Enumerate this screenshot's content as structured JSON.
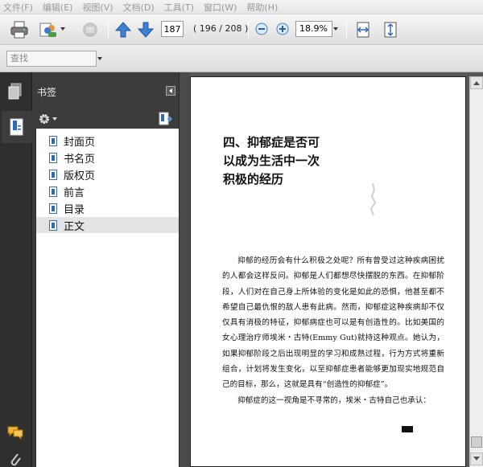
{
  "menu": [
    "文件(F)",
    "编辑(E)",
    "视图(V)",
    "文档(D)",
    "工具(T)",
    "窗口(W)",
    "帮助(H)"
  ],
  "toolbar": {
    "print_icon": "printer-icon",
    "page_number": "187",
    "page_count": "( 196 / 208 )",
    "zoom": "18.9%"
  },
  "find": {
    "placeholder": "查找"
  },
  "panel": {
    "title": "书签",
    "bookmarks": [
      {
        "label": "封面页"
      },
      {
        "label": "书名页"
      },
      {
        "label": "版权页"
      },
      {
        "label": "前言"
      },
      {
        "label": "目录"
      },
      {
        "label": "正文"
      }
    ],
    "selected_index": 5
  },
  "document": {
    "heading_lines": [
      "四、抑郁症是否可",
      "以成为生活中一次",
      "积极的经历"
    ],
    "paragraphs": [
      "抑郁的经历会有什么积极之处呢？所有曾受过这种疾病困扰的人都会这样反问。抑郁是人们都想尽快摆脱的东西。在抑郁阶段，人们对在自己身上所体验的变化是如此的恐惧，他甚至都不希望自己最仇恨的敌人患有此病。然而，抑郁症这种疾病却不仅仅具有消极的特征，抑郁病症也可以是有创造性的。比如美国的女心理治疗师埃米・古特(Emmy Gut)就持这种观点。她认为，如果抑郁阶段之后出现明显的学习和成熟过程，行为方式将重新组合，计划将发生变化，以至抑郁症患者能够更加现实地规范自己的目标，那么，这就是具有“创造性的抑郁症”。",
      "抑郁症的这一视角是不寻常的，埃米・古特自己也承认："
    ]
  },
  "colors": {
    "workspace": "#585858",
    "panel": "#3c3c3c",
    "accent_blue": "#2d6bb5"
  }
}
